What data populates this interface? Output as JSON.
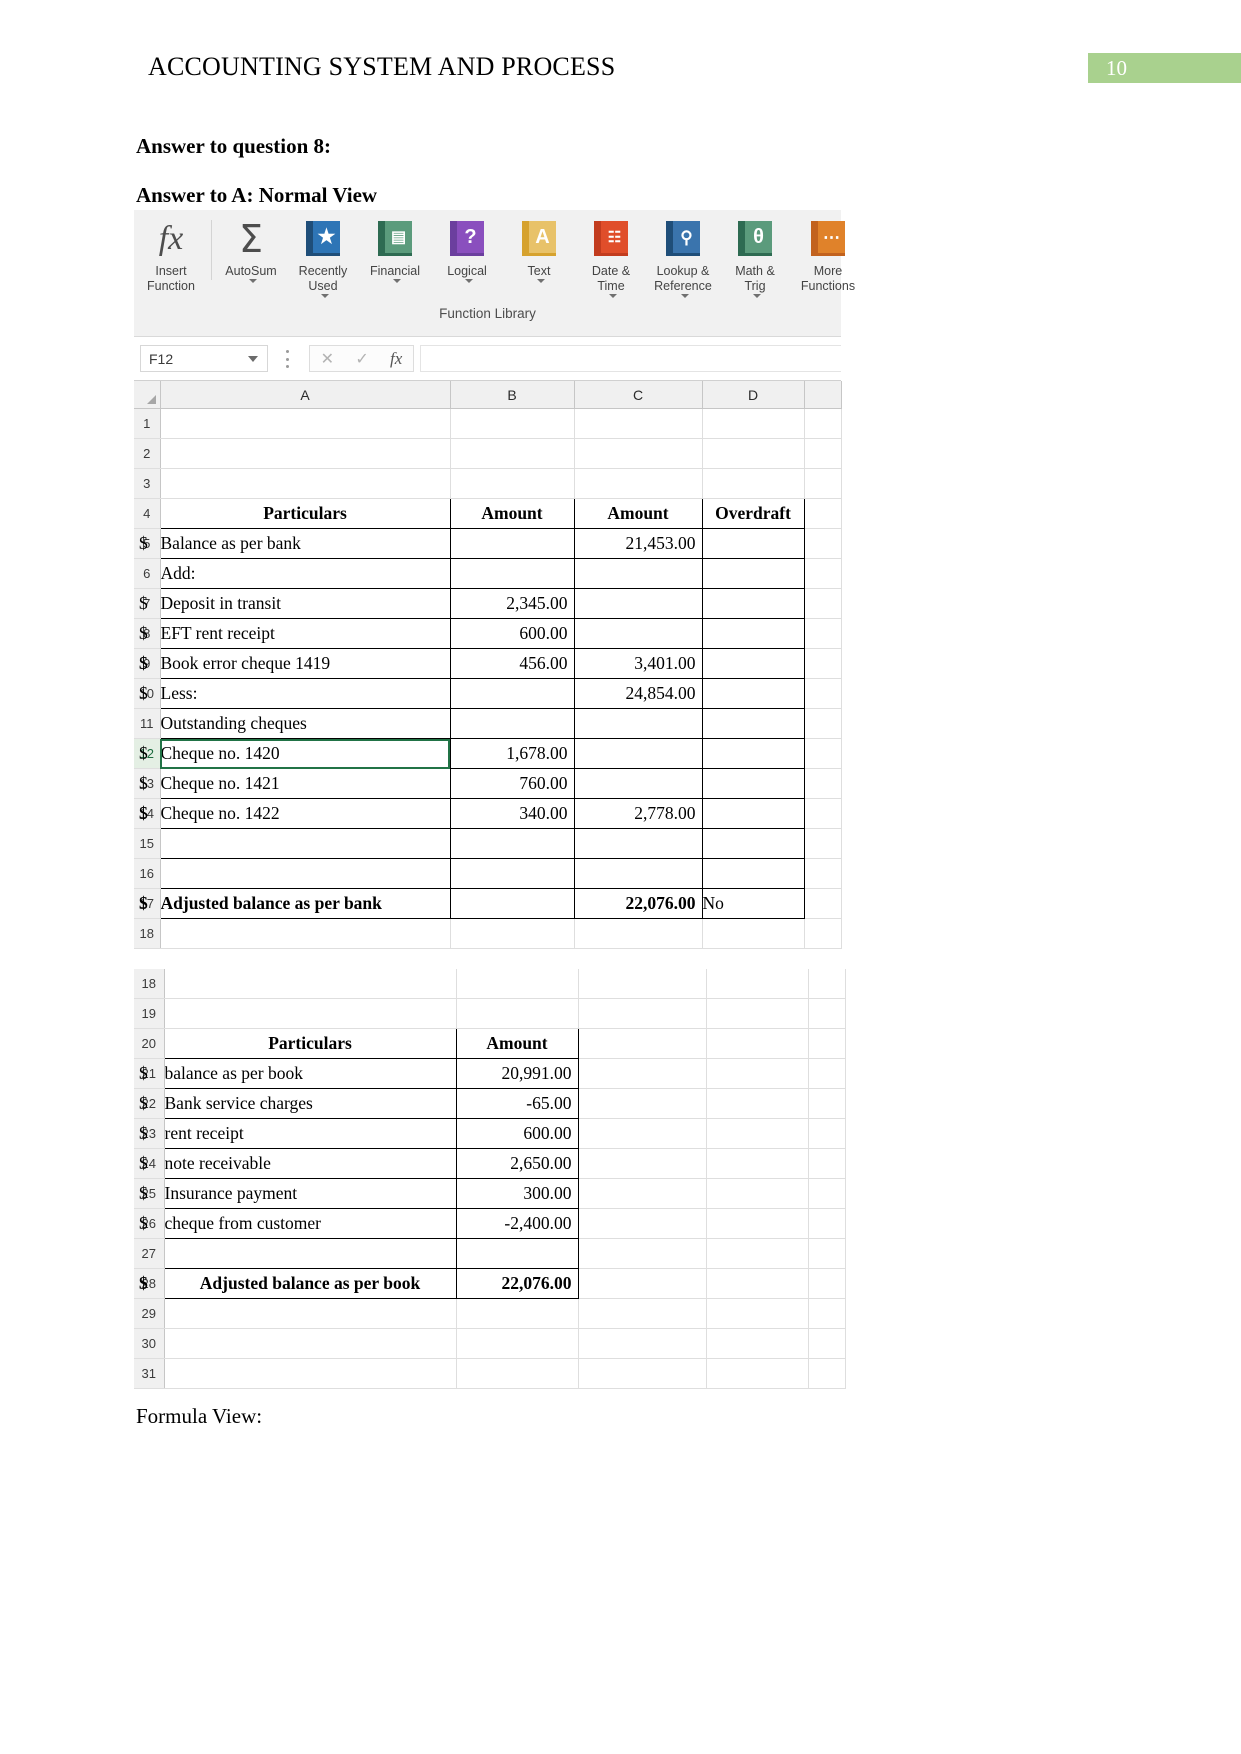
{
  "header": {
    "doc_title": "ACCOUNTING SYSTEM AND PROCESS",
    "page_number": "10"
  },
  "body": {
    "heading_question": "Answer to question 8:",
    "heading_answer": "Answer to A: Normal View",
    "formula_view_label": "Formula View:"
  },
  "ribbon": {
    "group_label": "Function Library",
    "buttons": [
      {
        "icon": "insert-function-icon",
        "label": "Insert\nFunction",
        "caret": false
      },
      {
        "icon": "autosum-icon",
        "label": "AutoSum",
        "caret": true
      },
      {
        "icon": "recently-used-icon",
        "label": "Recently\nUsed",
        "caret": true
      },
      {
        "icon": "financial-icon",
        "label": "Financial",
        "caret": true
      },
      {
        "icon": "logical-icon",
        "label": "Logical",
        "caret": true
      },
      {
        "icon": "text-icon",
        "label": "Text",
        "caret": true
      },
      {
        "icon": "date-time-icon",
        "label": "Date &\nTime",
        "caret": true
      },
      {
        "icon": "lookup-reference-icon",
        "label": "Lookup &\nReference",
        "caret": true
      },
      {
        "icon": "math-trig-icon",
        "label": "Math &\nTrig",
        "caret": true
      },
      {
        "icon": "more-functions-icon",
        "label": "More\nFunctions",
        "caret": false
      }
    ]
  },
  "formula_bar": {
    "name_box_value": "F12",
    "cancel_label": "✕",
    "enter_label": "✓",
    "insert_function_label": "fx",
    "formula_value": ""
  },
  "sheet1": {
    "column_headers": [
      "A",
      "B",
      "C",
      "D"
    ],
    "selected_row": 12,
    "rows": [
      {
        "n": 1,
        "a": "",
        "b": "",
        "bv": "",
        "c": "",
        "cv": "",
        "d": ""
      },
      {
        "n": 2,
        "a": "",
        "b": "",
        "bv": "",
        "c": "",
        "cv": "",
        "d": ""
      },
      {
        "n": 3,
        "a": "",
        "b": "",
        "bv": "",
        "c": "",
        "cv": "",
        "d": ""
      },
      {
        "n": 4,
        "a": "Particulars",
        "b": "",
        "bv": "Amount",
        "c": "",
        "cv": "Amount",
        "d": "Overdraft"
      },
      {
        "n": 5,
        "a": "Balance as per bank",
        "b": "",
        "bv": "",
        "c": "$",
        "cv": "21,453.00",
        "d": ""
      },
      {
        "n": 6,
        "a": "Add:",
        "b": "",
        "bv": "",
        "c": "",
        "cv": "",
        "d": ""
      },
      {
        "n": 7,
        "a": "Deposit in transit",
        "b": "$",
        "bv": "2,345.00",
        "c": "",
        "cv": "",
        "d": ""
      },
      {
        "n": 8,
        "a": "EFT rent receipt",
        "b": "$",
        "bv": "600.00",
        "c": "",
        "cv": "",
        "d": ""
      },
      {
        "n": 9,
        "a": "Book error cheque 1419",
        "b": "$",
        "bv": "456.00",
        "c": "$",
        "cv": "3,401.00",
        "d": ""
      },
      {
        "n": 10,
        "a": "Less:",
        "b": "",
        "bv": "",
        "c": "$",
        "cv": "24,854.00",
        "d": ""
      },
      {
        "n": 11,
        "a": "Outstanding cheques",
        "b": "",
        "bv": "",
        "c": "",
        "cv": "",
        "d": ""
      },
      {
        "n": 12,
        "a": "Cheque no. 1420",
        "b": "$",
        "bv": "1,678.00",
        "c": "",
        "cv": "",
        "d": ""
      },
      {
        "n": 13,
        "a": "Cheque no. 1421",
        "b": "$",
        "bv": "760.00",
        "c": "",
        "cv": "",
        "d": ""
      },
      {
        "n": 14,
        "a": "Cheque no. 1422",
        "b": "$",
        "bv": "340.00",
        "c": "$",
        "cv": "2,778.00",
        "d": ""
      },
      {
        "n": 15,
        "a": "",
        "b": "",
        "bv": "",
        "c": "",
        "cv": "",
        "d": ""
      },
      {
        "n": 16,
        "a": "",
        "b": "",
        "bv": "",
        "c": "",
        "cv": "",
        "d": ""
      },
      {
        "n": 17,
        "a": "Adjusted balance as per bank",
        "b": "",
        "bv": "",
        "c": "$",
        "cv": "22,076.00",
        "d": "No"
      },
      {
        "n": 18,
        "a": "",
        "b": "",
        "bv": "",
        "c": "",
        "cv": "",
        "d": ""
      }
    ]
  },
  "sheet2": {
    "rows": [
      {
        "n": 18,
        "a": "",
        "b": "",
        "bv": ""
      },
      {
        "n": 19,
        "a": "",
        "b": "",
        "bv": ""
      },
      {
        "n": 20,
        "a": "Particulars",
        "b": "",
        "bv": "Amount"
      },
      {
        "n": 21,
        "a": "balance as per book",
        "b": "$",
        "bv": "20,991.00"
      },
      {
        "n": 22,
        "a": "Bank service charges",
        "b": "$",
        "bv": "-65.00"
      },
      {
        "n": 23,
        "a": "rent receipt",
        "b": "$",
        "bv": "600.00"
      },
      {
        "n": 24,
        "a": "note receivable",
        "b": "$",
        "bv": "2,650.00"
      },
      {
        "n": 25,
        "a": "Insurance payment",
        "b": "$",
        "bv": "300.00"
      },
      {
        "n": 26,
        "a": "cheque from customer",
        "b": "$",
        "bv": "-2,400.00"
      },
      {
        "n": 27,
        "a": "",
        "b": "",
        "bv": ""
      },
      {
        "n": 28,
        "a": "Adjusted balance as per book",
        "b": "$",
        "bv": "22,076.00"
      },
      {
        "n": 29,
        "a": "",
        "b": "",
        "bv": ""
      },
      {
        "n": 30,
        "a": "",
        "b": "",
        "bv": ""
      },
      {
        "n": 31,
        "a": "",
        "b": "",
        "bv": ""
      }
    ]
  },
  "colors": {
    "page_badge": "#a9d18e",
    "excel_green": "#217346",
    "ribbon_bg": "#f1f1f1"
  }
}
